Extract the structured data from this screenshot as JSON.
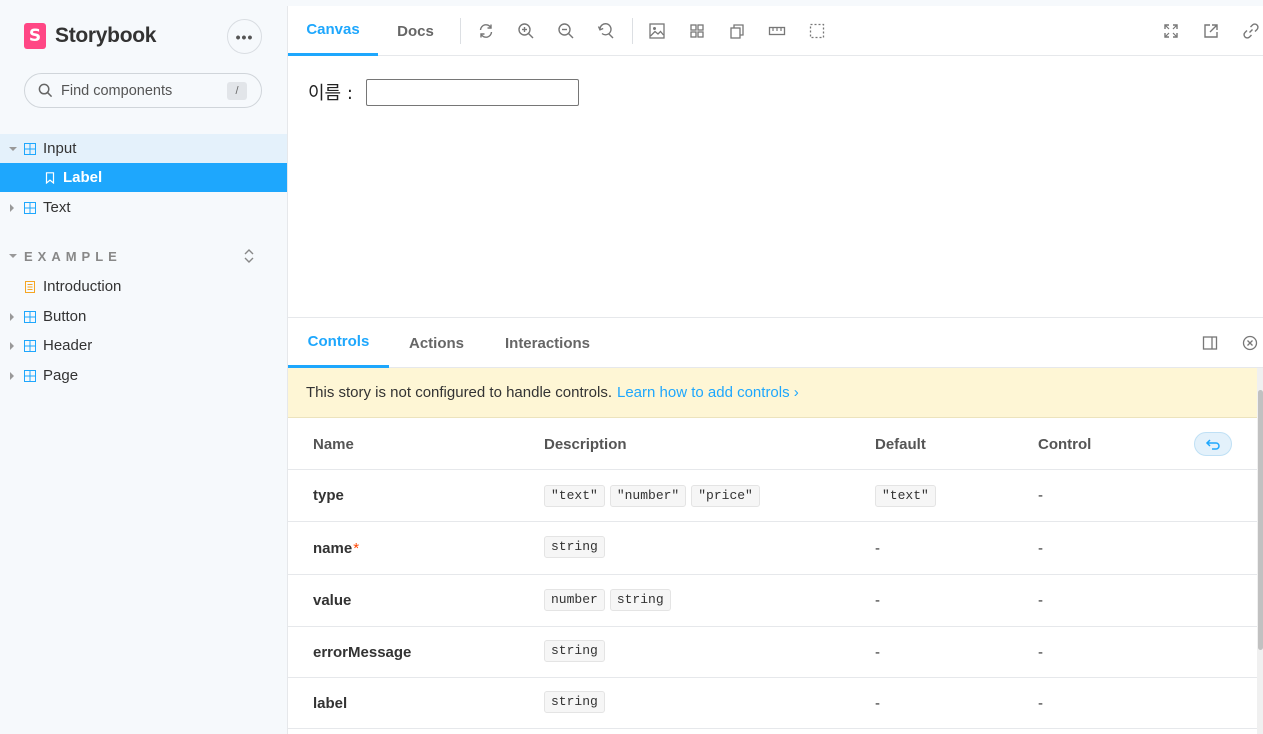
{
  "brand": {
    "name": "Storybook",
    "logo_letter": "S"
  },
  "sidebar": {
    "search_placeholder": "Find components",
    "search_shortcut": "/",
    "items": [
      {
        "label": "Input"
      },
      {
        "label": "Label"
      },
      {
        "label": "Text"
      }
    ],
    "section_title": "EXAMPLE",
    "example_items": [
      {
        "label": "Introduction"
      },
      {
        "label": "Button"
      },
      {
        "label": "Header"
      },
      {
        "label": "Page"
      }
    ]
  },
  "toolbar": {
    "tabs": [
      {
        "label": "Canvas"
      },
      {
        "label": "Docs"
      }
    ]
  },
  "canvas": {
    "field_label": "이름 :",
    "field_value": ""
  },
  "addons": {
    "tabs": [
      {
        "label": "Controls"
      },
      {
        "label": "Actions"
      },
      {
        "label": "Interactions"
      }
    ],
    "notice_text": "This story is not configured to handle controls.",
    "notice_link": "Learn how to add controls ›"
  },
  "table": {
    "headers": {
      "name": "Name",
      "description": "Description",
      "default": "Default",
      "control": "Control"
    },
    "rows": [
      {
        "name": "type",
        "required": "",
        "types": [
          "\"text\"",
          "\"number\"",
          "\"price\""
        ],
        "default": "\"text\"",
        "control": "-"
      },
      {
        "name": "name",
        "required": "*",
        "types": [
          "string"
        ],
        "default": "-",
        "control": "-"
      },
      {
        "name": "value",
        "required": "",
        "types": [
          "number",
          "string"
        ],
        "default": "-",
        "control": "-"
      },
      {
        "name": "errorMessage",
        "required": "",
        "types": [
          "string"
        ],
        "default": "-",
        "control": "-"
      },
      {
        "name": "label",
        "required": "",
        "types": [
          "string"
        ],
        "default": "-",
        "control": "-"
      }
    ]
  },
  "colors": {
    "accent": "#1ea7fd",
    "brand": "#ff4785",
    "notice_bg": "#fef6d5",
    "required": "#ff4400"
  }
}
